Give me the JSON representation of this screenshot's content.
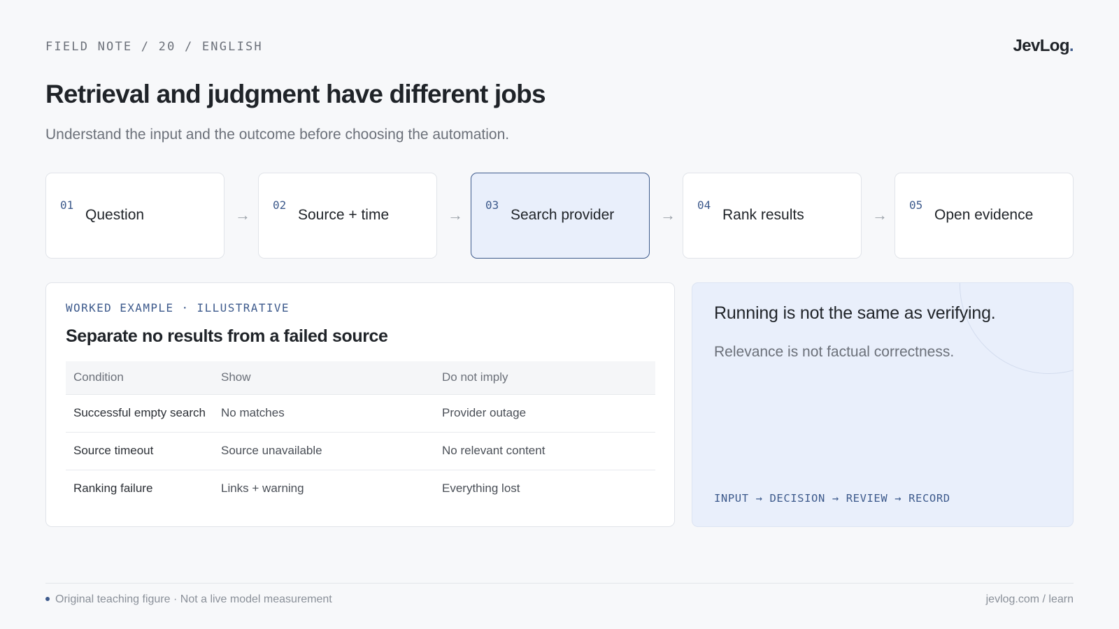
{
  "header": {
    "kicker": "FIELD NOTE / 20 / ENGLISH",
    "brand": "JevLog",
    "brand_dot": ".",
    "title": "Retrieval and judgment have different jobs",
    "subtitle": "Understand the input and the outcome before choosing the automation."
  },
  "steps": [
    {
      "num": "01",
      "label": "Question",
      "active": false
    },
    {
      "num": "02",
      "label": "Source + time",
      "active": false
    },
    {
      "num": "03",
      "label": "Search provider",
      "active": true
    },
    {
      "num": "04",
      "label": "Rank results",
      "active": false
    },
    {
      "num": "05",
      "label": "Open evidence",
      "active": false
    }
  ],
  "step_arrow": "→",
  "example": {
    "eyebrow": "WORKED EXAMPLE · ILLUSTRATIVE",
    "heading": "Separate no results from a failed source",
    "columns": [
      "Condition",
      "Show",
      "Do not imply"
    ],
    "rows": [
      [
        "Successful empty search",
        "No matches",
        "Provider outage"
      ],
      [
        "Source timeout",
        "Source unavailable",
        "No relevant content"
      ],
      [
        "Ranking failure",
        "Links + warning",
        "Everything lost"
      ]
    ]
  },
  "callout": {
    "headline": "Running is not the same as verifying.",
    "body": "Relevance is not factual correctness.",
    "flow": "INPUT → DECISION → REVIEW → RECORD"
  },
  "footer": {
    "note": "Original teaching figure · Not a live model measurement",
    "link": "jevlog.com / learn"
  },
  "colors": {
    "accent": "#3d5a8c",
    "active_step_bg": "#e9effb",
    "page_bg": "#f7f8fa"
  }
}
